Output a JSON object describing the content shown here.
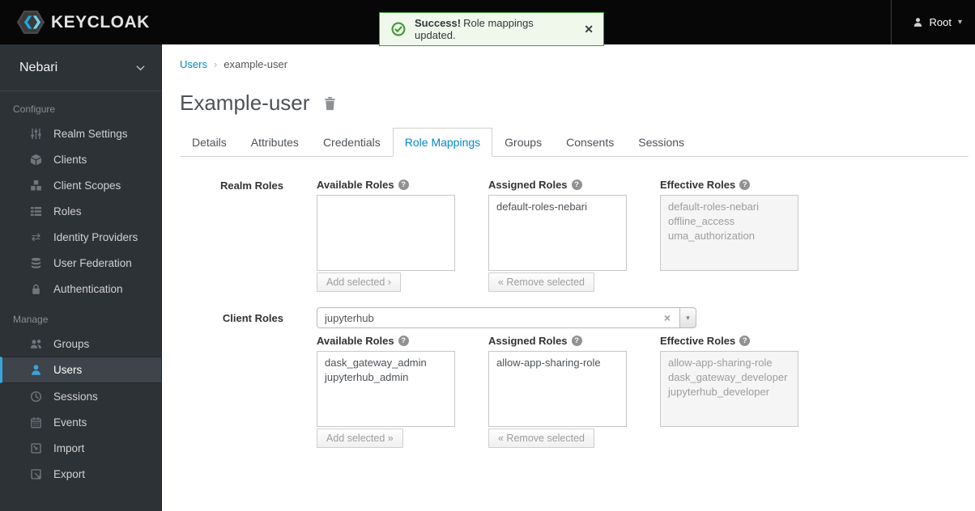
{
  "topbar": {
    "brand": "KEYCLOAK",
    "user": {
      "label": "Root"
    }
  },
  "alert": {
    "title": "Success!",
    "message": "Role mappings updated."
  },
  "icons": {
    "close": "✕",
    "caret": "▾",
    "clear": "×",
    "exchange": "⇄",
    "help": "?",
    "breadcrumb_sep": "›"
  },
  "sidebar": {
    "realm": "Nebari",
    "sections": [
      {
        "label": "Configure",
        "items": [
          {
            "label": "Realm Settings",
            "icon": "sliders-icon"
          },
          {
            "label": "Clients",
            "icon": "cube-icon"
          },
          {
            "label": "Client Scopes",
            "icon": "cubes-icon"
          },
          {
            "label": "Roles",
            "icon": "list-icon"
          },
          {
            "label": "Identity Providers",
            "icon": "exchange-icon"
          },
          {
            "label": "User Federation",
            "icon": "database-icon"
          },
          {
            "label": "Authentication",
            "icon": "lock-icon"
          }
        ]
      },
      {
        "label": "Manage",
        "items": [
          {
            "label": "Groups",
            "icon": "users-icon"
          },
          {
            "label": "Users",
            "icon": "user-icon",
            "active": true
          },
          {
            "label": "Sessions",
            "icon": "clock-icon"
          },
          {
            "label": "Events",
            "icon": "calendar-icon"
          },
          {
            "label": "Import",
            "icon": "import-icon"
          },
          {
            "label": "Export",
            "icon": "export-icon"
          }
        ]
      }
    ]
  },
  "breadcrumb": {
    "link": "Users",
    "current": "example-user"
  },
  "page": {
    "title": "Example-user"
  },
  "tabs": [
    {
      "label": "Details"
    },
    {
      "label": "Attributes"
    },
    {
      "label": "Credentials"
    },
    {
      "label": "Role Mappings",
      "active": true
    },
    {
      "label": "Groups"
    },
    {
      "label": "Consents"
    },
    {
      "label": "Sessions"
    }
  ],
  "realm_roles": {
    "section_label": "Realm Roles",
    "available": {
      "header": "Available Roles",
      "items": [],
      "button": "Add selected ›"
    },
    "assigned": {
      "header": "Assigned Roles",
      "items": [
        "default-roles-nebari"
      ],
      "button": "« Remove selected"
    },
    "effective": {
      "header": "Effective Roles",
      "items": [
        "default-roles-nebari",
        "offline_access",
        "uma_authorization"
      ]
    }
  },
  "client_roles": {
    "section_label": "Client Roles",
    "client_select": {
      "value": "jupyterhub"
    },
    "available": {
      "header": "Available Roles",
      "items": [
        "dask_gateway_admin",
        "jupyterhub_admin"
      ],
      "button": "Add selected »"
    },
    "assigned": {
      "header": "Assigned Roles",
      "items": [
        "allow-app-sharing-role"
      ],
      "button": "« Remove selected"
    },
    "effective": {
      "header": "Effective Roles",
      "items": [
        "allow-app-sharing-role",
        "dask_gateway_developer",
        "jupyterhub_developer"
      ]
    }
  },
  "colors": {
    "accent_blue": "#0088ce",
    "sidebar_active_blue": "#39a5dc",
    "success_green": "#3f9c35",
    "topbar_black": "#070707",
    "sidebar_bg": "#2d3237"
  }
}
